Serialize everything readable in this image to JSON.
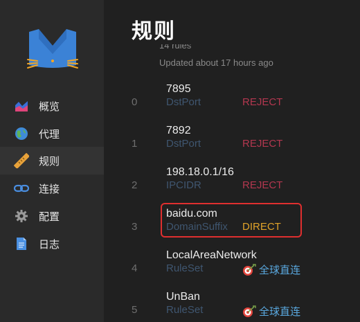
{
  "sidebar": {
    "items": [
      {
        "label": "概览",
        "icon": "chart-icon"
      },
      {
        "label": "代理",
        "icon": "globe-icon"
      },
      {
        "label": "规则",
        "icon": "ruler-icon"
      },
      {
        "label": "连接",
        "icon": "link-icon"
      },
      {
        "label": "配置",
        "icon": "gear-icon"
      },
      {
        "label": "日志",
        "icon": "document-icon"
      }
    ],
    "active": "规则"
  },
  "header": {
    "title": "规则",
    "count": "14 rules",
    "updated": "Updated about 17 hours ago"
  },
  "rules": [
    {
      "index": "0",
      "payload": "7895",
      "type": "DstPort",
      "proxy": "REJECT"
    },
    {
      "index": "1",
      "payload": "7892",
      "type": "DstPort",
      "proxy": "REJECT"
    },
    {
      "index": "2",
      "payload": "198.18.0.1/16",
      "type": "IPCIDR",
      "proxy": "REJECT"
    },
    {
      "index": "3",
      "payload": "baidu.com",
      "type": "DomainSuffix",
      "proxy": "DIRECT"
    },
    {
      "index": "4",
      "payload": "LocalAreaNetwork",
      "type": "RuleSet",
      "proxy": "全球直连"
    },
    {
      "index": "5",
      "payload": "UnBan",
      "type": "RuleSet",
      "proxy": "全球直连"
    }
  ],
  "colors": {
    "reject": "#b3374f",
    "direct": "#e0a329",
    "group": "#5aa9e0",
    "highlight": "#e02f2f"
  }
}
